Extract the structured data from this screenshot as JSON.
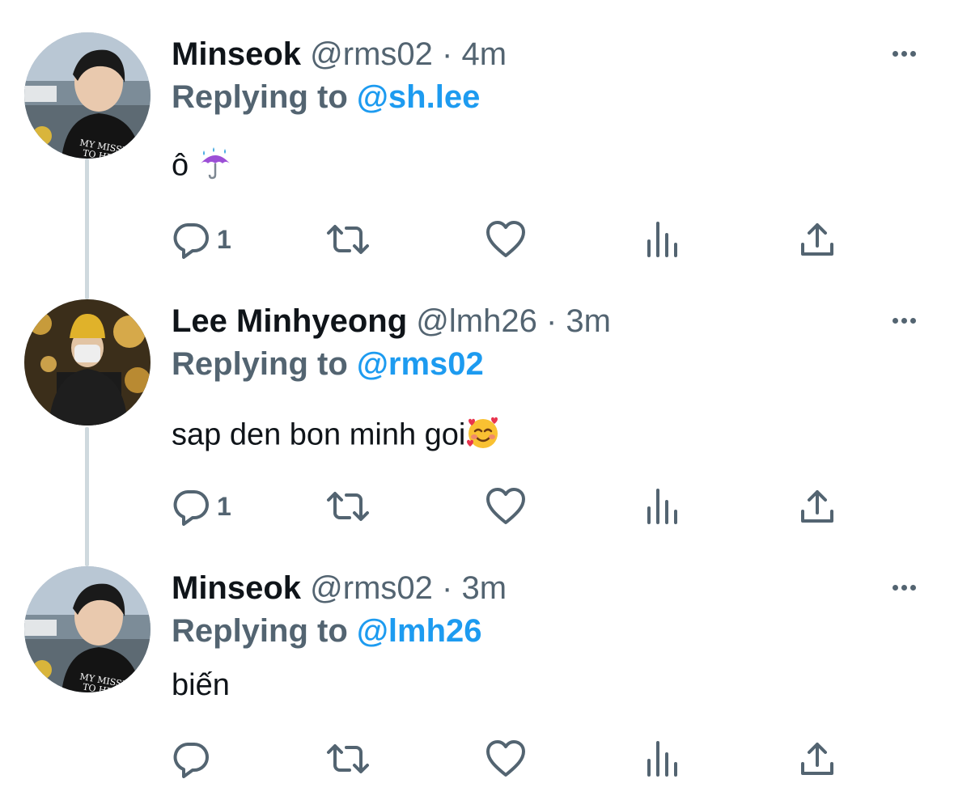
{
  "tweets": [
    {
      "name": "Minseok",
      "handle": "@rms02",
      "separator": "·",
      "time": "4m",
      "reply_prefix": "Replying to",
      "reply_to": "@sh.lee",
      "text": "ô",
      "emoji": "umbrella-with-rain-icon",
      "reply_count": "1",
      "avatar": "avatar-minseok"
    },
    {
      "name": "Lee Minhyeong",
      "handle": "@lmh26",
      "separator": "·",
      "time": "3m",
      "reply_prefix": "Replying to",
      "reply_to": "@rms02",
      "text": "sap den bon minh goi",
      "emoji": "smiling-face-with-hearts-icon",
      "reply_count": "1",
      "avatar": "avatar-lee-minhyeong"
    },
    {
      "name": "Minseok",
      "handle": "@rms02",
      "separator": "·",
      "time": "3m",
      "reply_prefix": "Replying to",
      "reply_to": "@lmh26",
      "text": "biến",
      "emoji": "",
      "reply_count": "",
      "avatar": "avatar-minseok"
    }
  ],
  "colors": {
    "text": "#0f1419",
    "secondary": "#536471",
    "accent": "#1d9bf0",
    "thread_line": "#cfd9de"
  },
  "icons": {
    "reply": "reply-icon",
    "retweet": "retweet-icon",
    "like": "heart-icon",
    "views": "views-icon",
    "share": "share-icon",
    "more": "more-icon"
  }
}
